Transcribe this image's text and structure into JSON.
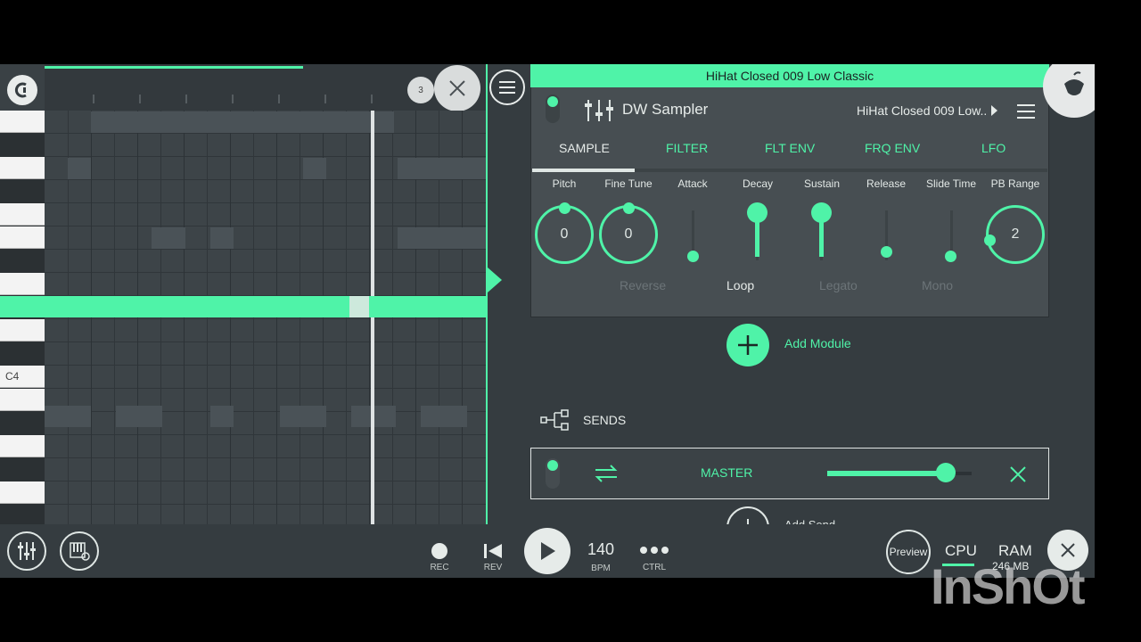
{
  "plugin": {
    "title_bar": "HiHat Closed 009 Low Classic",
    "name": "DW Sampler",
    "sample_short": "HiHat Closed 009 Low..",
    "tabs": [
      "SAMPLE",
      "FILTER",
      "FLT ENV",
      "FRQ ENV",
      "LFO"
    ],
    "active_tab": "SAMPLE",
    "params": {
      "pitch": {
        "label": "Pitch",
        "value": "0"
      },
      "fine_tune": {
        "label": "Fine Tune",
        "value": "0"
      },
      "attack": {
        "label": "Attack"
      },
      "decay": {
        "label": "Decay"
      },
      "sustain": {
        "label": "Sustain"
      },
      "release": {
        "label": "Release"
      },
      "slide_time": {
        "label": "Slide Time"
      },
      "pb_range": {
        "label": "PB Range",
        "value": "2"
      }
    },
    "options": {
      "reverse": "Reverse",
      "loop": "Loop",
      "legato": "Legato",
      "mono": "Mono"
    },
    "add_module": "Add Module",
    "sends": "SENDS",
    "master": "MASTER",
    "master_level": 0.82,
    "add_send": "Add Send"
  },
  "roll": {
    "note_label": "C4",
    "badge": "3"
  },
  "transport": {
    "rec": "REC",
    "rev": "REV",
    "bpm_value": "140",
    "bpm": "BPM",
    "ctrl": "CTRL",
    "preview": "Preview",
    "cpu": "CPU",
    "ram": "RAM",
    "ram_value": "246 MB"
  },
  "watermark": "InShOt",
  "colors": {
    "accent": "#4ff3a8",
    "panel": "#474e52",
    "background": "#353c40"
  }
}
